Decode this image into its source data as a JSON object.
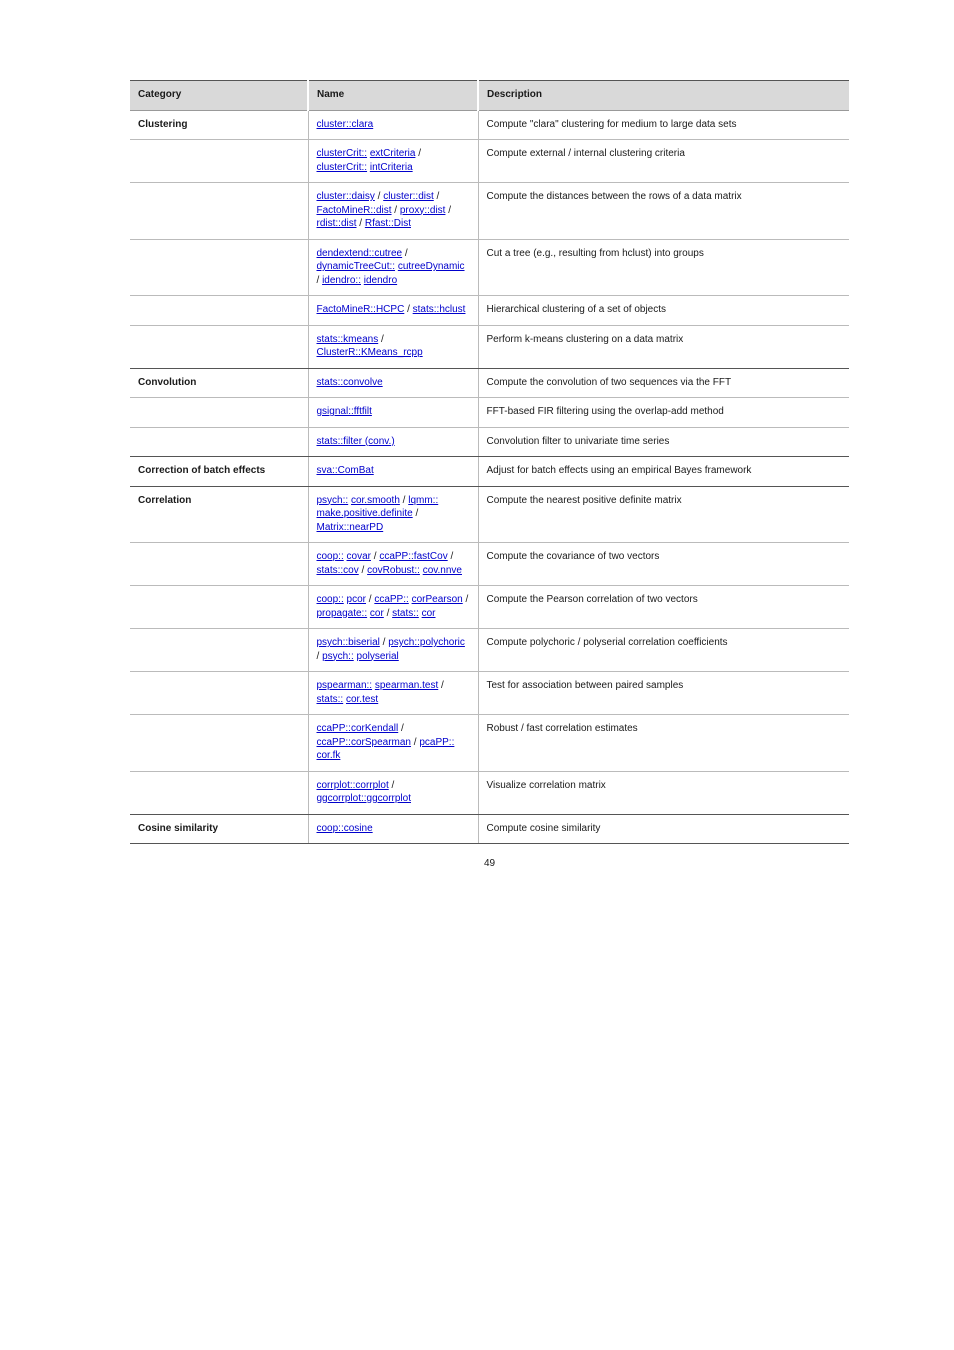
{
  "page_number": "49",
  "header": {
    "col0": "Category",
    "col1": "Name",
    "col2": "Description"
  },
  "rows": [
    {
      "category": "Clustering",
      "name_html": "<a>cluster::clara</a>",
      "desc": "Compute \"clara\" clustering for medium to large data sets",
      "section_end": false
    },
    {
      "category": "",
      "name_html": "<a href='#'>clusterCrit::</a> <a href='#'>extCriteria</a> / <a href='#'>clusterCrit::</a> <a href='#'>intCriteria</a>",
      "desc": "Compute external / internal clustering criteria",
      "section_end": false
    },
    {
      "category": "",
      "name_html": "<a href='#'>cluster::daisy</a> / <a href='#'>cluster::dist</a> / <a href='#'>FactoMineR::dist</a> / <a href='#'>proxy::dist</a> / <a href='#'>rdist::dist</a> / <a href='#'>Rfast::Dist</a>",
      "desc": "Compute the distances between the rows of a data matrix",
      "section_end": false
    },
    {
      "category": "",
      "name_html": "<a href='#'>dendextend::cutree</a> / <a href='#'>dynamicTreeCut::</a> <a href='#'>cutreeDynamic</a> / <a href='#'>idendro::</a> <a href='#'>idendro</a>",
      "desc": "Cut a tree (e.g., resulting from hclust) into groups",
      "section_end": false
    },
    {
      "category": "",
      "name_html": "<a href='#'>FactoMineR::HCPC</a> / <a href='#'>stats::hclust</a>",
      "desc": "Hierarchical clustering of a set of objects",
      "section_end": false
    },
    {
      "category": "",
      "name_html": "<a href='#'>stats::kmeans</a> / <a href='#'>ClusterR::KMeans_rcpp</a>",
      "desc": "Perform k-means clustering on a data matrix",
      "section_end": true
    },
    {
      "category": "Convolution",
      "name_html": "<a href='#'>stats::convolve</a>",
      "desc": "Compute the convolution of two sequences via the FFT",
      "section_end": false
    },
    {
      "category": "",
      "name_html": "<a href='#'>gsignal::fftfilt</a>",
      "desc": "FFT-based FIR filtering using the overlap-add method",
      "section_end": false
    },
    {
      "category": "",
      "name_html": "<a href='#'>stats::filter (conv.)</a>",
      "desc": "Convolution filter to univariate time series",
      "section_end": true
    },
    {
      "category": "Correction of batch effects",
      "name_html": "<a href='#'>sva::ComBat</a>",
      "desc": "Adjust for batch effects using an empirical Bayes framework",
      "section_end": true
    },
    {
      "category": "Correlation",
      "name_html": "<a href='#'>psych::</a> <a href='#'>cor.smooth</a> / <a href='#'>lqmm::</a> <a href='#'>make.positive.definite</a> / <a href='#'>Matrix::nearPD</a>",
      "desc": "Compute the nearest positive definite matrix",
      "section_end": false
    },
    {
      "category": "",
      "name_html": "<a href='#'>coop::</a> <a href='#'>covar</a> / <a href='#'>ccaPP::fastCov</a> / <a href='#'>stats::cov</a> / <a href='#'>covRobust::</a> <a href='#'>cov.nnve</a>",
      "desc": "Compute the covariance of two vectors",
      "section_end": false
    },
    {
      "category": "",
      "name_html": "<a href='#'>coop::</a> <a href='#'>pcor</a> / <a href='#'>ccaPP::</a> <a href='#'>corPearson</a> / <a href='#'>propagate::</a> <a href='#'>cor</a> / <a href='#'>stats::</a> <a href='#'>cor</a>",
      "desc": "Compute the Pearson correlation of two vectors",
      "section_end": false
    },
    {
      "category": "",
      "name_html": "<a href='#'>psych::biserial</a> / <a href='#'>psych::polychoric</a> / <a href='#'>psych::</a> <a href='#'>polyserial</a>",
      "desc": "Compute polychoric / polyserial correlation coefficients",
      "section_end": false
    },
    {
      "category": "",
      "name_html": "<a href='#'>pspearman::</a> <a href='#'>spearman.test</a> / <a href='#'>stats::</a> <a href='#'>cor.test</a>",
      "desc": "Test for association between paired samples",
      "section_end": false
    },
    {
      "category": "",
      "name_html": "<a href='#'>ccaPP::corKendall</a> / <a href='#'>ccaPP::corSpearman</a> / <a href='#'>pcaPP::</a> <a href='#'>cor.fk</a>",
      "desc": "Robust / fast correlation estimates",
      "section_end": false
    },
    {
      "category": "",
      "name_html": "<a href='#'>corrplot::corrplot</a> / <a href='#'>ggcorrplot::ggcorrplot</a>",
      "desc": "Visualize correlation matrix",
      "section_end": true
    },
    {
      "category": "Cosine similarity",
      "name_html": "<a href='#'>coop::cosine</a>",
      "desc": "Compute cosine similarity",
      "section_end": true
    }
  ]
}
